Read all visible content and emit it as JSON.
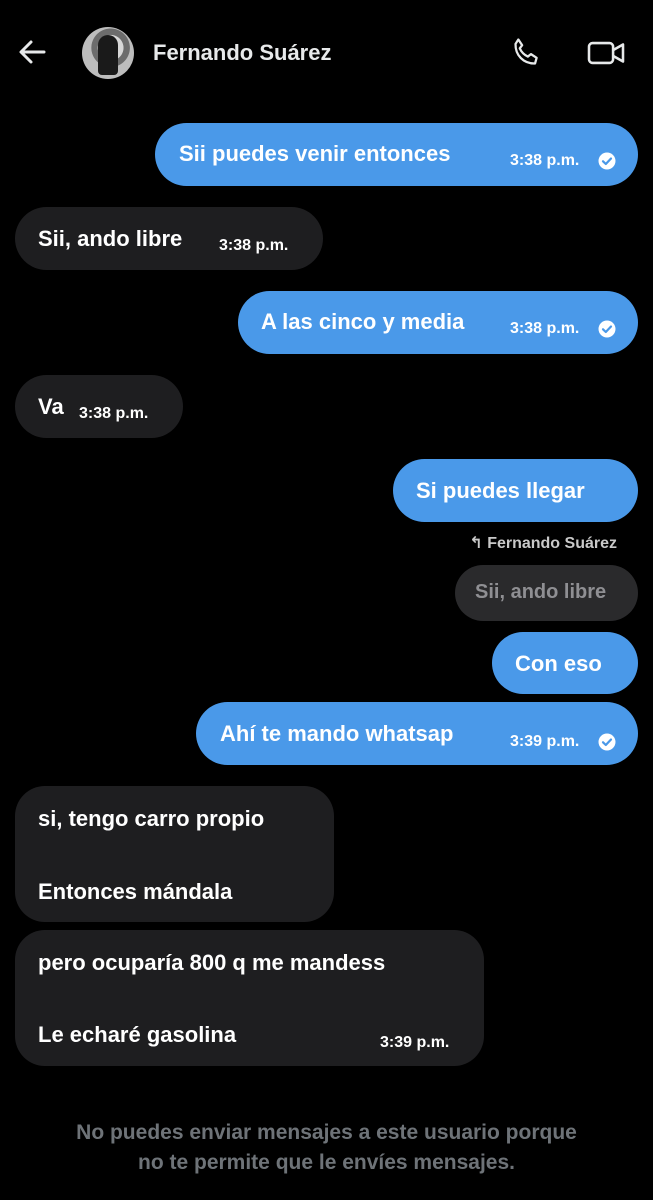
{
  "header": {
    "contact_name": "Fernando Suárez"
  },
  "messages": [
    {
      "text": "Sii puedes venir entonces",
      "time": "3:38 p.m."
    },
    {
      "text": "Sii, ando libre",
      "time": "3:38 p.m."
    },
    {
      "text": "A las cinco y media",
      "time": "3:38 p.m."
    },
    {
      "text": "Va",
      "time": "3:38 p.m."
    },
    {
      "text": "Si puedes llegar"
    },
    {
      "reply_to": "Fernando Suárez",
      "quoted": "Sii, ando libre"
    },
    {
      "text": "Con eso"
    },
    {
      "text": "Ahí te mando whatsap",
      "time": "3:39 p.m."
    },
    {
      "line1": "si, tengo carro propio",
      "line2": "Entonces mándala"
    },
    {
      "line1": "pero ocuparía 800 q me mandess",
      "line2": "Le echaré gasolina",
      "time": "3:39 p.m."
    }
  ],
  "footer": {
    "line1": "No puedes enviar mensajes a este usuario porque",
    "line2": "no te permite que le envíes mensajes."
  },
  "colors": {
    "outgoing": "#4a99e9",
    "incoming": "#1e1e20",
    "background": "#000000"
  }
}
